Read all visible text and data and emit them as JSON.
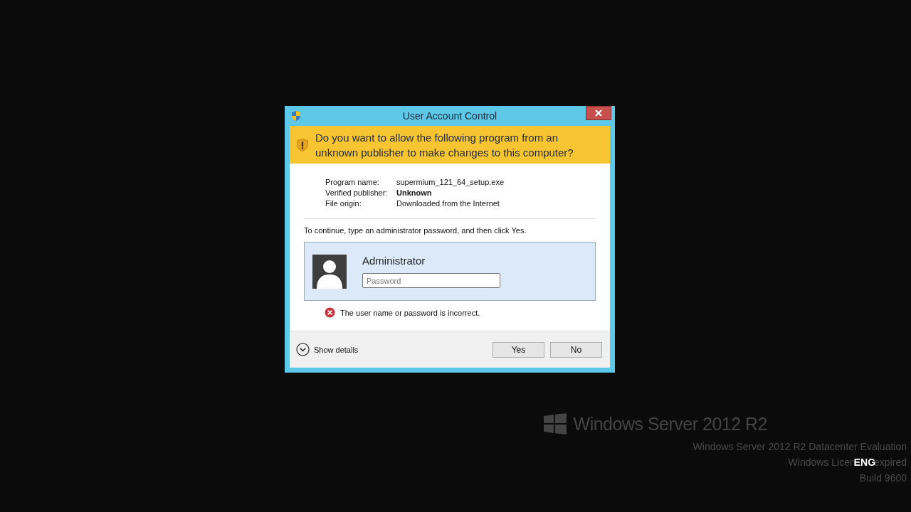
{
  "dialog": {
    "title": "User Account Control",
    "question": "Do you want to allow the following program from an unknown publisher to make changes to this computer?",
    "details": [
      {
        "label": "Program name:",
        "value": "supermium_121_64_setup.exe",
        "bold": false
      },
      {
        "label": "Verified publisher:",
        "value": "Unknown",
        "bold": true
      },
      {
        "label": "File origin:",
        "value": "Downloaded from the Internet",
        "bold": false
      }
    ],
    "instruction": "To continue, type an administrator password, and then click Yes.",
    "account": {
      "name": "Administrator",
      "selected": true,
      "password": {
        "placeholder": "Password"
      }
    },
    "error": "The user name or password is incorrect.",
    "show_details": {
      "label": "Show details",
      "expanded": false
    },
    "buttons": [
      {
        "label": "Yes"
      },
      {
        "label": "No"
      }
    ]
  },
  "watermark": {
    "logo": "Windows Server 2012 R2",
    "lines": [
      {
        "parts": [
          "Windows Server 2012 R2 Datacenter Evaluation"
        ]
      },
      {
        "parts": [
          "Windows Licen",
          "ENG",
          "expired"
        ]
      },
      {
        "parts": [
          "Build 9600"
        ]
      }
    ]
  }
}
